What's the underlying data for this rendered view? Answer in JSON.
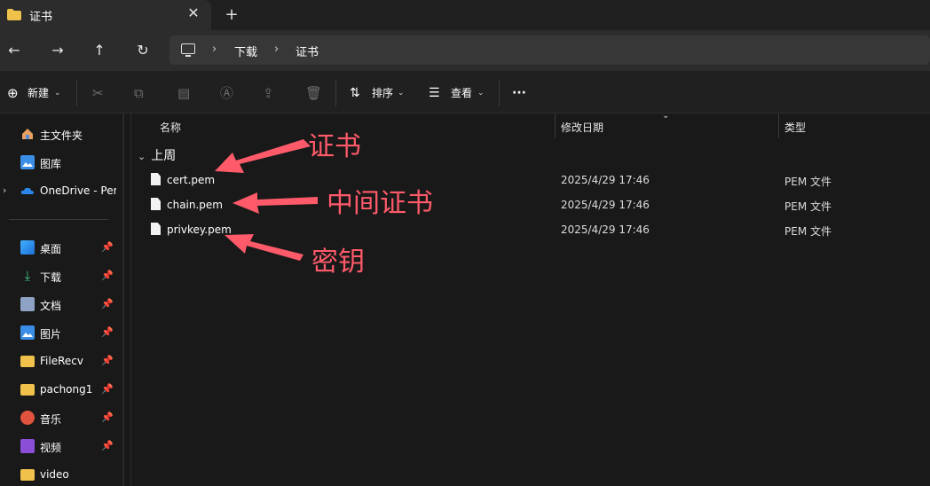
{
  "window": {
    "tab_title": "证书",
    "close_symbol": "✕",
    "newtab_symbol": "+"
  },
  "address": {
    "crumbs": [
      "下载",
      "证书"
    ]
  },
  "commandbar": {
    "new_label": "新建",
    "sort_label": "排序",
    "view_label": "查看",
    "more_label": "···"
  },
  "sidebar": {
    "items": [
      {
        "label": "主文件夹",
        "icon": "home-icon",
        "pinned": false
      },
      {
        "label": "图库",
        "icon": "gallery-icon",
        "pinned": false
      },
      {
        "label": "OneDrive - Per",
        "icon": "cloud-icon",
        "pinned": false
      },
      {
        "label": "桌面",
        "icon": "desktop-icon",
        "pinned": true
      },
      {
        "label": "下载",
        "icon": "download-icon",
        "pinned": true
      },
      {
        "label": "文档",
        "icon": "document-icon",
        "pinned": true
      },
      {
        "label": "图片",
        "icon": "pictures-icon",
        "pinned": true
      },
      {
        "label": "FileRecv",
        "icon": "folder-icon",
        "pinned": true
      },
      {
        "label": "pachong1",
        "icon": "folder-icon",
        "pinned": true
      },
      {
        "label": "音乐",
        "icon": "music-icon",
        "pinned": true
      },
      {
        "label": "视频",
        "icon": "video-icon",
        "pinned": true
      },
      {
        "label": "video",
        "icon": "folder-icon",
        "pinned": false
      }
    ]
  },
  "columns": {
    "name": "名称",
    "date": "修改日期",
    "type": "类型"
  },
  "group_label": "上周",
  "files": [
    {
      "name": "cert.pem",
      "date": "2025/4/29 17:46",
      "type": "PEM 文件"
    },
    {
      "name": "chain.pem",
      "date": "2025/4/29 17:46",
      "type": "PEM 文件"
    },
    {
      "name": "privkey.pem",
      "date": "2025/4/29 17:46",
      "type": "PEM 文件"
    }
  ],
  "annotations": {
    "cert": "证书",
    "chain": "中间证书",
    "privkey": "密钥"
  },
  "colors": {
    "annotation": "#ff5a6a",
    "folder": "#f0c14b",
    "accent": "#4fa3ff"
  }
}
